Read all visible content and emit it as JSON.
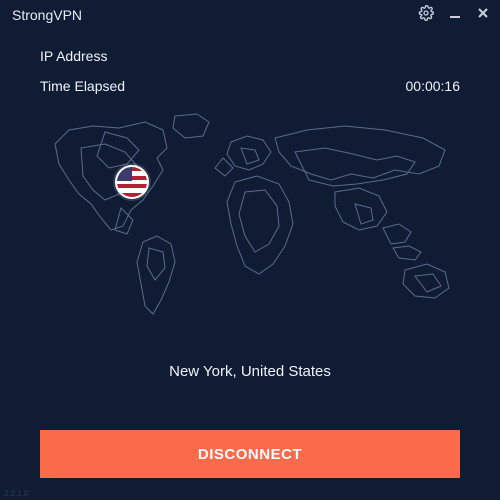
{
  "app": {
    "title": "StrongVPN"
  },
  "info": {
    "ip_label": "IP Address",
    "ip_value": "",
    "time_label": "Time Elapsed",
    "time_value": "00:00:16"
  },
  "location": {
    "flag_icon": "us-flag-icon",
    "text": "New York, United States"
  },
  "actions": {
    "disconnect_label": "DISCONNECT"
  },
  "meta": {
    "version": "2.2.1.0"
  },
  "colors": {
    "accent": "#fb6a4a",
    "bg": "#0f1c34"
  }
}
